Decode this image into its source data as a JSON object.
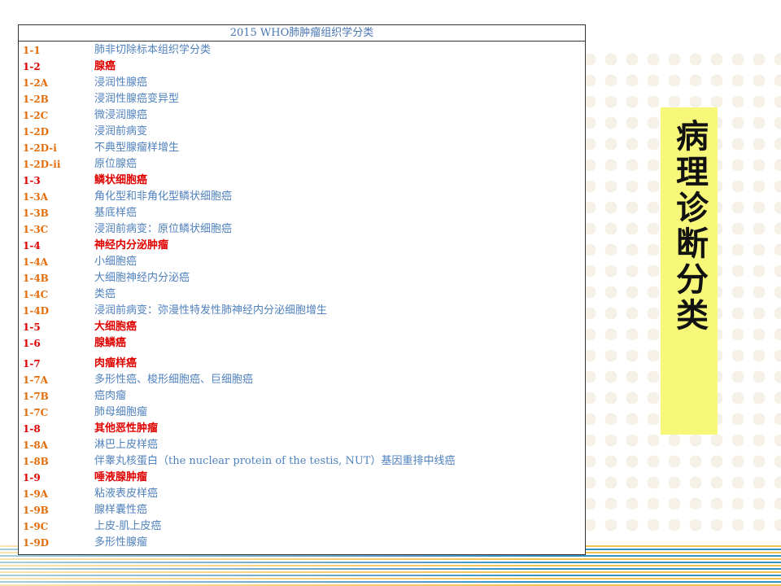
{
  "slide": {
    "table_title": "2015 WHO肺肿瘤组织学分类",
    "side_title": "病理诊断分类",
    "rows": [
      {
        "code": "1-1",
        "name": "肺非切除标本组织学分类",
        "main": false
      },
      {
        "code": "1-2",
        "name": "腺癌",
        "main": true
      },
      {
        "code": "1-2A",
        "name": "浸润性腺癌",
        "main": false
      },
      {
        "code": "1-2B",
        "name": "浸润性腺癌变异型",
        "main": false
      },
      {
        "code": "1-2C",
        "name": "微浸润腺癌",
        "main": false
      },
      {
        "code": "1-2D",
        "name": "浸润前病变",
        "main": false
      },
      {
        "code": "1-2D-i",
        "name": "不典型腺瘤样增生",
        "main": false
      },
      {
        "code": "1-2D-ii",
        "name": "原位腺癌",
        "main": false
      },
      {
        "code": "1-3",
        "name": "鳞状细胞癌",
        "main": true
      },
      {
        "code": "1-3A",
        "name": "角化型和非角化型鳞状细胞癌",
        "main": false
      },
      {
        "code": "1-3B",
        "name": "基底样癌",
        "main": false
      },
      {
        "code": "1-3C",
        "name": "浸润前病变：原位鳞状细胞癌",
        "main": false
      },
      {
        "code": "1-4",
        "name": "神经内分泌肿瘤",
        "main": true
      },
      {
        "code": "1-4A",
        "name": "小细胞癌",
        "main": false
      },
      {
        "code": "1-4B",
        "name": "大细胞神经内分泌癌",
        "main": false
      },
      {
        "code": "1-4C",
        "name": "类癌",
        "main": false
      },
      {
        "code": "1-4D",
        "name": "浸润前病变：弥漫性特发性肺神经内分泌细胞增生",
        "main": false
      },
      {
        "code": "1-5",
        "name": "大细胞癌",
        "main": true
      },
      {
        "code": "1-6",
        "name": "腺鳞癌",
        "main": true
      },
      {
        "code": "1-7",
        "name": "肉瘤样癌",
        "main": true
      },
      {
        "code": "1-7A",
        "name": "多形性癌、梭形细胞癌、巨细胞癌",
        "main": false
      },
      {
        "code": "1-7B",
        "name": "癌肉瘤",
        "main": false
      },
      {
        "code": "1-7C",
        "name": "肺母细胞瘤",
        "main": false
      },
      {
        "code": "1-8",
        "name": "其他恶性肿瘤",
        "main": true
      },
      {
        "code": "1-8A",
        "name": "淋巴上皮样癌",
        "main": false
      },
      {
        "code": "1-8B",
        "name": "伴睾丸核蛋白（the nuclear protein of the testis, NUT）基因重排中线癌",
        "main": false
      },
      {
        "code": "1-9",
        "name": "唾液腺肿瘤",
        "main": true
      },
      {
        "code": "1-9A",
        "name": "粘液表皮样癌",
        "main": false
      },
      {
        "code": "1-9B",
        "name": "腺样囊性癌",
        "main": false
      },
      {
        "code": "1-9C",
        "name": "上皮-肌上皮癌",
        "main": false
      },
      {
        "code": "1-9D",
        "name": "多形性腺瘤",
        "main": false
      }
    ]
  }
}
